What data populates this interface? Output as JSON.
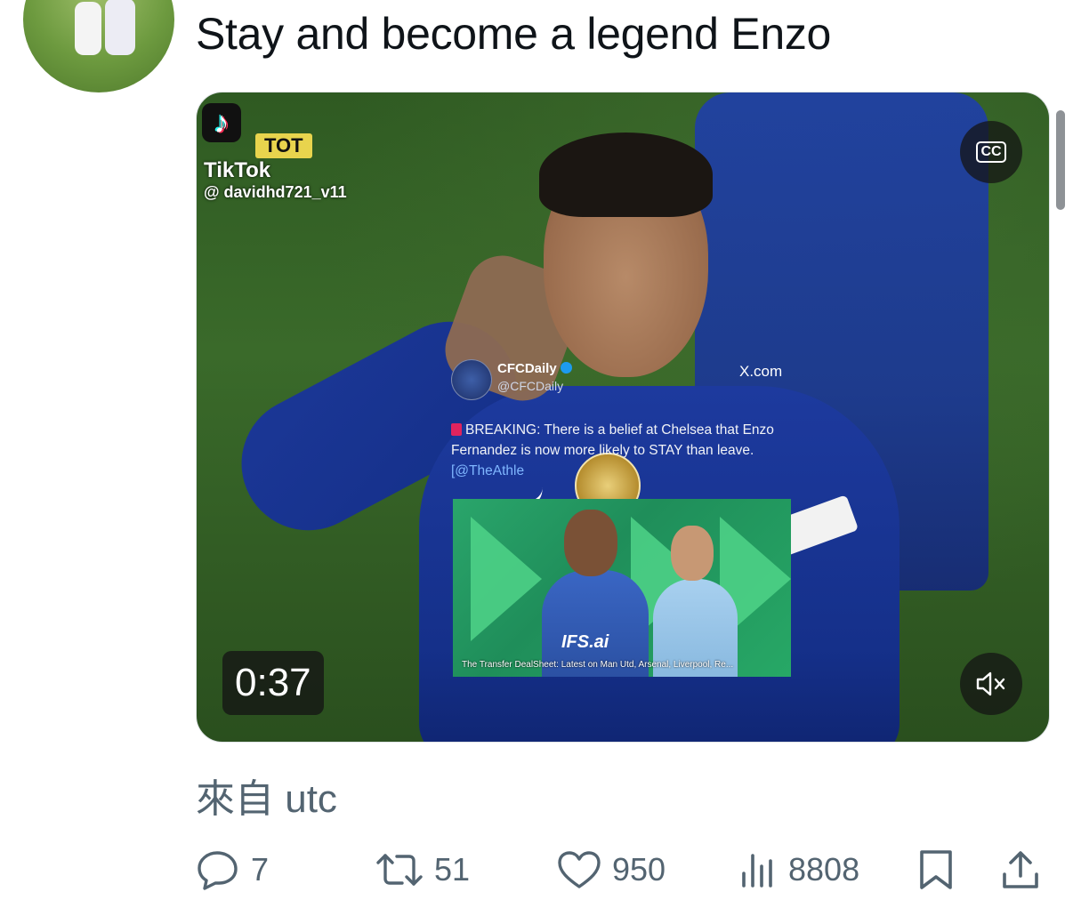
{
  "tweet": {
    "text": "Stay and become a legend Enzo",
    "source": "來自 utc"
  },
  "video": {
    "duration": "0:37",
    "cc_label": "CC",
    "watermark": {
      "app": "TikTok",
      "badge": "TOT",
      "handle": "@ davidhd721_v11"
    },
    "embedded_post": {
      "name": "CFCDaily",
      "handle": "@CFCDaily",
      "site": "X.com",
      "text": "BREAKING: There is a belief at Chelsea that Enzo Fernandez is now more likely to STAY than leave.",
      "link": "[@TheAthle",
      "image_text": "IFS.ai",
      "caption": "The Transfer DealSheet: Latest on Man Utd, Arsenal, Liverpool, Re..."
    }
  },
  "actions": {
    "replies": "7",
    "retweets": "51",
    "likes": "950",
    "views": "8808"
  },
  "colors": {
    "text": "#0f1419",
    "secondary": "#536471"
  },
  "icons": [
    "reply-icon",
    "retweet-icon",
    "like-icon",
    "views-icon",
    "bookmark-icon",
    "share-icon",
    "cc-icon",
    "mute-icon"
  ]
}
